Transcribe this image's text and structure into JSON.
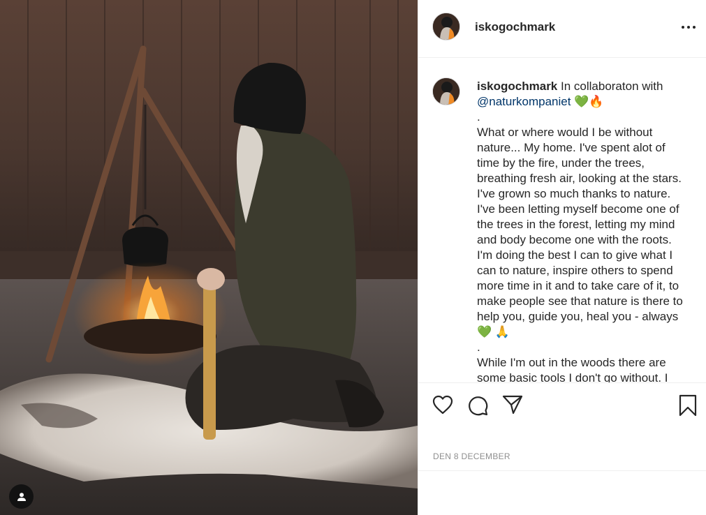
{
  "post": {
    "username": "iskogochmark",
    "caption_intro": "In collaboraton with",
    "mention": "@naturkompaniet",
    "emoji_green_heart": "💚",
    "emoji_fire": "🔥",
    "emoji_pray": "🙏",
    "dot": ".",
    "body_text": "What or where would I be without nature... My home. I've spent alot of time by the fire, under the trees, breathing fresh air, looking at the stars. I've grown so much thanks to nature. I've been letting myself become one of the trees in the forest, letting my mind and body become one with the roots. I'm doing the best I can to give what I can to nature, inspire others to spend more time in it and to take care of it, to make people see that nature is there to help you, guide you, heal you - always",
    "more_text": "While I'm out in the woods there are some basic tools I don't go without. I",
    "date": "DEN 8 DECEMBER"
  },
  "icons": {
    "more": "more-options-icon",
    "like": "heart-outline-icon",
    "comment": "speech-bubble-icon",
    "share": "paper-plane-icon",
    "save": "bookmark-icon",
    "tag": "user-tag-icon"
  },
  "colors": {
    "text": "#262626",
    "mention": "#003569",
    "muted": "#8e8e8e",
    "divider": "#efefef"
  }
}
